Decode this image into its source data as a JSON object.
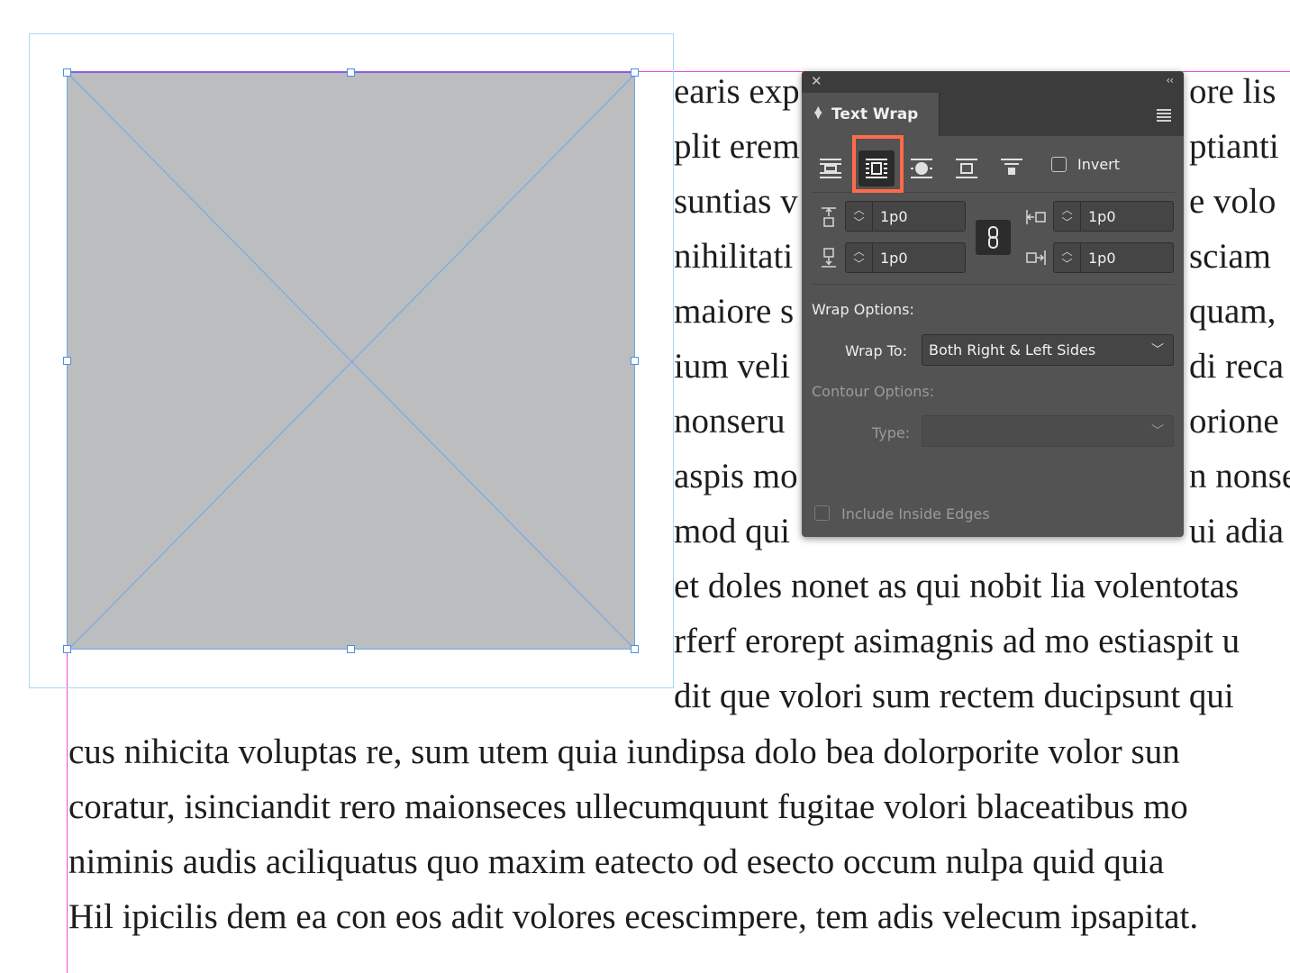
{
  "document": {
    "lines_right": [
      "earis exp",
      "plit erem",
      "suntias v",
      "nihilitati",
      "maiore s",
      "ium veli",
      "nonseru",
      "aspis mo",
      "mod qui",
      "et doles nonet as qui nobit lia volentotas",
      "rferf erorept asimagnis ad mo estiaspit u",
      "dit que volori sum rectem ducipsunt qui"
    ],
    "lines_right_tail": [
      "ore lis",
      "ptianti",
      "e volo",
      "sciam",
      "quam,",
      "di reca",
      "orione",
      "n nonse",
      "ui adia"
    ],
    "lines_full": [
      "cus nihicita voluptas re, sum utem quia iundipsa dolo bea dolorporite volor sun",
      "coratur, isinciandit rero maionseces ullecumquunt fugitae volori blaceatibus mo",
      "niminis audis aciliquatus quo maxim eatecto od esecto occum nulpa quid quia",
      "Hil ipicilis dem ea con eos adit volores ecescimpere, tem adis velecum ipsapitat."
    ]
  },
  "panel": {
    "close_icon": "close-icon",
    "collapse_label": "‹‹",
    "title": "Text Wrap",
    "invert_label": "Invert",
    "invert_checked": false,
    "wrap_buttons": [
      {
        "name": "no-text-wrap-icon",
        "selected": false
      },
      {
        "name": "wrap-around-bounding-box-icon",
        "selected": true
      },
      {
        "name": "wrap-around-object-shape-icon",
        "selected": false
      },
      {
        "name": "jump-object-icon",
        "selected": false
      },
      {
        "name": "jump-to-next-column-icon",
        "selected": false
      }
    ],
    "offsets": {
      "top": "1p0",
      "bottom": "1p0",
      "left": "1p0",
      "right": "1p0"
    },
    "wrap_options_label": "Wrap Options:",
    "wrap_to_label": "Wrap To:",
    "wrap_to_value": "Both Right & Left Sides",
    "contour_options_label": "Contour Options:",
    "type_label": "Type:",
    "type_value": "",
    "include_inside_edges_label": "Include Inside Edges",
    "include_inside_edges_checked": false
  },
  "colors": {
    "highlight": "#ff6a4a",
    "panel_bg": "#535353",
    "frame_fill": "#bcbdbf",
    "frame_stroke": "#6aa8e8",
    "guide": "#e64ae6"
  }
}
